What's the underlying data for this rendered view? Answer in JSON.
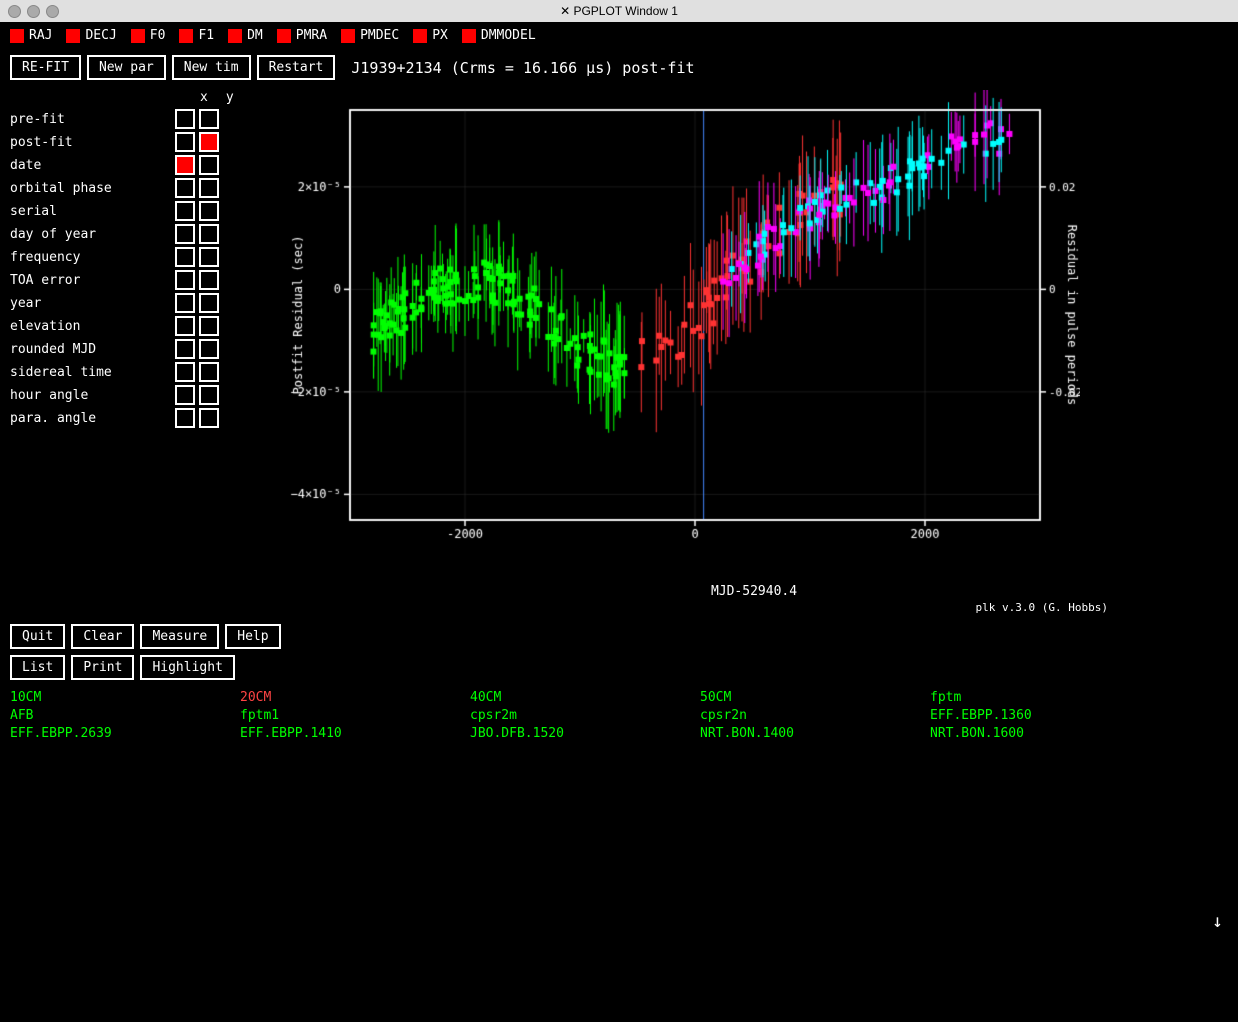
{
  "titlebar": {
    "title": "✕ PGPLOT Window 1"
  },
  "params": [
    {
      "label": "RAJ"
    },
    {
      "label": "DECJ"
    },
    {
      "label": "F0"
    },
    {
      "label": "F1"
    },
    {
      "label": "DM"
    },
    {
      "label": "PMRA"
    },
    {
      "label": "PMDEC"
    },
    {
      "label": "PX"
    },
    {
      "label": "DMMODEL"
    }
  ],
  "toolbar": {
    "refit": "RE-FIT",
    "newpar": "New par",
    "newtim": "New tim",
    "restart": "Restart",
    "plot_title": "J1939+2134 (Crms = 16.166 μs) post-fit"
  },
  "rows": [
    {
      "label": "pre-fit",
      "x_filled": false,
      "y_filled": false
    },
    {
      "label": "post-fit",
      "x_filled": false,
      "y_filled": true
    },
    {
      "label": "date",
      "x_filled": true,
      "y_filled": false
    },
    {
      "label": "orbital phase",
      "x_filled": false,
      "y_filled": false
    },
    {
      "label": "serial",
      "x_filled": false,
      "y_filled": false
    },
    {
      "label": "day of year",
      "x_filled": false,
      "y_filled": false
    },
    {
      "label": "frequency",
      "x_filled": false,
      "y_filled": false
    },
    {
      "label": "TOA error",
      "x_filled": false,
      "y_filled": false
    },
    {
      "label": "year",
      "x_filled": false,
      "y_filled": false
    },
    {
      "label": "elevation",
      "x_filled": false,
      "y_filled": false
    },
    {
      "label": "rounded MJD",
      "x_filled": false,
      "y_filled": false
    },
    {
      "label": "sidereal time",
      "x_filled": false,
      "y_filled": false
    },
    {
      "label": "hour angle",
      "x_filled": false,
      "y_filled": false
    },
    {
      "label": "para. angle",
      "x_filled": false,
      "y_filled": false
    }
  ],
  "plot": {
    "ylabel_left": "Postfit Residual (sec)",
    "ylabel_right": "Residual in pulse periods",
    "xlabel": "MJD-52940.4",
    "version": "plk v.3.0 (G. Hobbs)"
  },
  "bottom_buttons": [
    {
      "label": "Quit",
      "row": 1
    },
    {
      "label": "Clear",
      "row": 1
    },
    {
      "label": "Measure",
      "row": 1
    },
    {
      "label": "Help",
      "row": 1
    },
    {
      "label": "List",
      "row": 2
    },
    {
      "label": "Print",
      "row": 2
    },
    {
      "label": "Highlight",
      "row": 2
    }
  ],
  "legend": [
    {
      "label": "10CM",
      "color": "green"
    },
    {
      "label": "20CM",
      "color": "red"
    },
    {
      "label": "40CM",
      "color": "green"
    },
    {
      "label": "50CM",
      "color": "green"
    },
    {
      "label": "fptm",
      "color": "green"
    },
    {
      "label": "AFB",
      "color": "green"
    },
    {
      "label": "fptm1",
      "color": "green"
    },
    {
      "label": "cpsr2m",
      "color": "green"
    },
    {
      "label": "cpsr2n",
      "color": "green"
    },
    {
      "label": "EFF.EBPP.1360",
      "color": "green"
    },
    {
      "label": "EFF.EBPP.2639",
      "color": "green"
    },
    {
      "label": "EFF.EBPP.1410",
      "color": "green"
    },
    {
      "label": "JBO.DFB.1520",
      "color": "green"
    },
    {
      "label": "NRT.BON.1400",
      "color": "green"
    },
    {
      "label": "NRT.BON.1600",
      "color": "green"
    }
  ]
}
